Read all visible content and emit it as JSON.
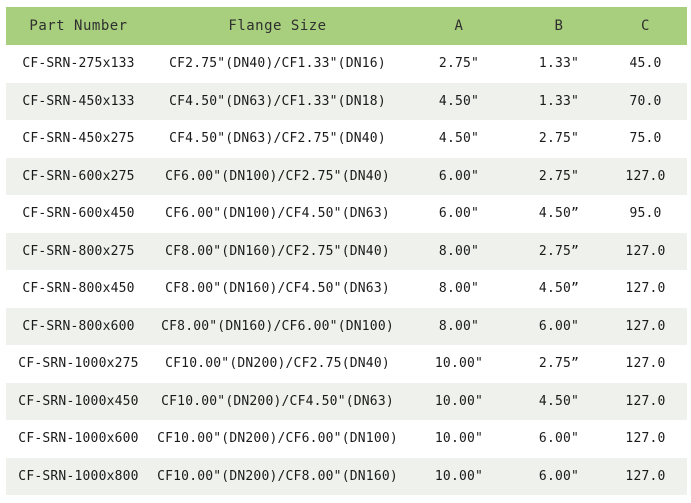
{
  "table": {
    "headers": [
      "Part Number",
      "Flange Size",
      "A",
      "B",
      "C"
    ],
    "rows": [
      [
        "CF-SRN-275x133",
        "CF2.75\"(DN40)/CF1.33\"(DN16)",
        "2.75\"",
        "1.33\"",
        "45.0"
      ],
      [
        "CF-SRN-450x133",
        "CF4.50\"(DN63)/CF1.33\"(DN18)",
        "4.50\"",
        "1.33\"",
        "70.0"
      ],
      [
        "CF-SRN-450x275",
        "CF4.50\"(DN63)/CF2.75\"(DN40)",
        "4.50\"",
        "2.75\"",
        "75.0"
      ],
      [
        "CF-SRN-600x275",
        "CF6.00\"(DN100)/CF2.75\"(DN40)",
        "6.00\"",
        "2.75\"",
        "127.0"
      ],
      [
        "CF-SRN-600x450",
        "CF6.00\"(DN100)/CF4.50\"(DN63)",
        "6.00\"",
        "4.50”",
        "95.0"
      ],
      [
        "CF-SRN-800x275",
        "CF8.00\"(DN160)/CF2.75\"(DN40)",
        "8.00\"",
        "2.75”",
        "127.0"
      ],
      [
        "CF-SRN-800x450",
        "CF8.00\"(DN160)/CF4.50\"(DN63)",
        "8.00\"",
        "4.50”",
        "127.0"
      ],
      [
        "CF-SRN-800x600",
        "CF8.00\"(DN160)/CF6.00\"(DN100)",
        "8.00\"",
        "6.00\"",
        "127.0"
      ],
      [
        "CF-SRN-1000x275",
        "CF10.00\"(DN200)/CF2.75(DN40)",
        "10.00\"",
        "2.75”",
        "127.0"
      ],
      [
        "CF-SRN-1000x450",
        "CF10.00\"(DN200)/CF4.50\"(DN63)",
        "10.00\"",
        "4.50\"",
        "127.0"
      ],
      [
        "CF-SRN-1000x600",
        "CF10.00\"(DN200)/CF6.00\"(DN100)",
        "10.00\"",
        "6.00\"",
        "127.0"
      ],
      [
        "CF-SRN-1000x800",
        "CF10.00\"(DN200)/CF8.00\"(DN160)",
        "10.00\"",
        "6.00\"",
        "127.0"
      ]
    ]
  },
  "colors": {
    "header_bg": "#a8cf7d",
    "stripe_bg": "#eef1ec"
  }
}
